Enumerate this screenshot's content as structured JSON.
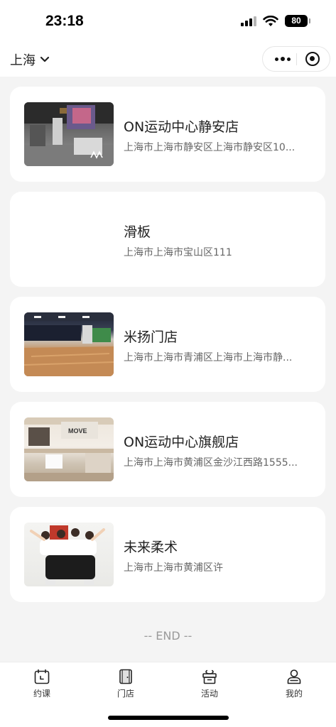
{
  "status_bar": {
    "time": "23:18",
    "battery": "80"
  },
  "nav": {
    "city": "上海"
  },
  "stores": [
    {
      "name": "ON运动中心静安店",
      "address": "上海市上海市静安区上海市静安区10...",
      "image": "gym-interior"
    },
    {
      "name": "滑板",
      "address": "上海市上海市宝山区111",
      "image": ""
    },
    {
      "name": "米扬门店",
      "address": "上海市上海市青浦区上海市上海市静...",
      "image": "dance-studio"
    },
    {
      "name": "ON运动中心旗舰店",
      "address": "上海市上海市黄浦区金沙江西路1555...",
      "image": "flagship-interior"
    },
    {
      "name": "未来柔术",
      "address": "上海市上海市黄浦区许",
      "image": "bjj-group-photo"
    }
  ],
  "end_text": "-- END --",
  "tabs": [
    {
      "label": "约课",
      "icon": "calendar-icon"
    },
    {
      "label": "门店",
      "icon": "store-icon"
    },
    {
      "label": "活动",
      "icon": "gift-icon"
    },
    {
      "label": "我的",
      "icon": "user-icon"
    }
  ]
}
